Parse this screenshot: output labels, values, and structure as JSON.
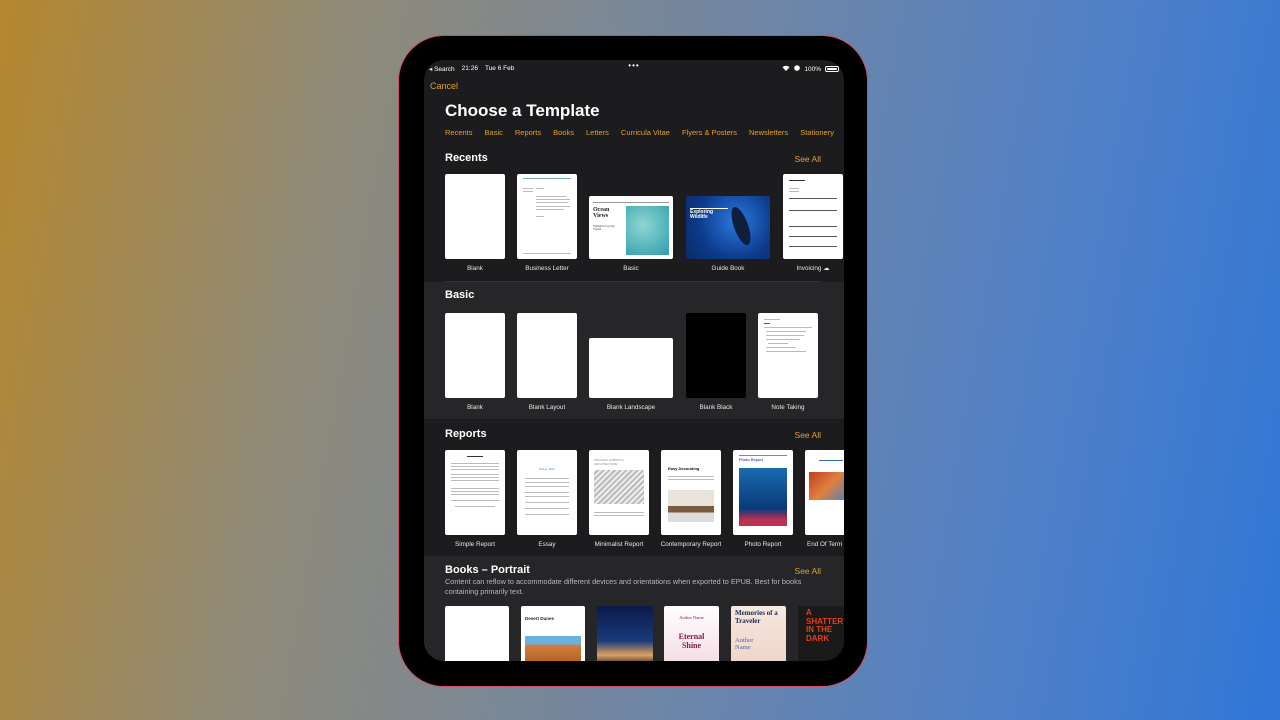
{
  "statusbar": {
    "back_app": "◂ Search",
    "time": "21:26",
    "date": "Tue 6 Feb",
    "multitask": "•••",
    "battery": "100%"
  },
  "header": {
    "cancel_label": "Cancel",
    "title": "Choose a Template",
    "tabs": [
      "Recents",
      "Basic",
      "Reports",
      "Books",
      "Letters",
      "Curricula Vitae",
      "Flyers & Posters",
      "Newsletters",
      "Stationery"
    ]
  },
  "sections": {
    "recents": {
      "title": "Recents",
      "see_all": "See All",
      "items": [
        {
          "label": "Blank"
        },
        {
          "label": "Business Letter"
        },
        {
          "label": "Basic",
          "thumb_title": "Ocean Views",
          "thumb_sub": "Highlights From My Travels"
        },
        {
          "label": "Guide Book",
          "thumb_title": "Exploring Wildlife"
        },
        {
          "label": "Invoicing",
          "icon": "cloud-download-icon"
        }
      ]
    },
    "basic": {
      "title": "Basic",
      "items": [
        {
          "label": "Blank"
        },
        {
          "label": "Blank Layout"
        },
        {
          "label": "Blank Landscape"
        },
        {
          "label": "Blank Black"
        },
        {
          "label": "Note Taking"
        }
      ]
    },
    "reports": {
      "title": "Reports",
      "see_all": "See All",
      "items": [
        {
          "label": "Simple Report"
        },
        {
          "label": "Essay",
          "thumb_title": "Essay Title"
        },
        {
          "label": "Minimalist Report",
          "thumb_title": "ORGANIC FORMS IN ARCHITECTURE"
        },
        {
          "label": "Contemporary Report",
          "thumb_title": "Easy Decorating"
        },
        {
          "label": "Photo Report",
          "thumb_title": "Photo Report"
        },
        {
          "label": "End Of Term"
        }
      ]
    },
    "books": {
      "title": "Books – Portrait",
      "see_all": "See All",
      "description": "Content can reflow to accommodate different devices and orientations when exported to EPUB. Best for books containing primarily text.",
      "items": [
        {
          "thumb_title": ""
        },
        {
          "thumb_title": "Desert Dunes"
        },
        {
          "thumb_title": ""
        },
        {
          "thumb_title": "Eternal Shine",
          "thumb_author": "Author Name"
        },
        {
          "thumb_title": "Memories of a Traveler",
          "thumb_author": "Author Name"
        },
        {
          "thumb_title": "A SHATTER IN THE DARK"
        }
      ]
    }
  },
  "colors": {
    "accent": "#e0a030",
    "background": "#1c1c1e",
    "section_alt": "#262628"
  }
}
